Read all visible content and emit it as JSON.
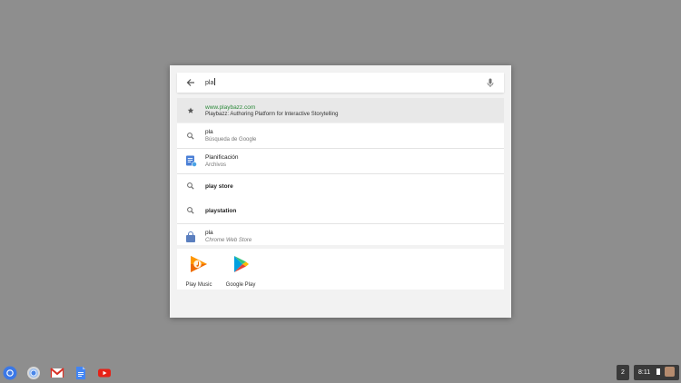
{
  "search": {
    "query": "pla"
  },
  "results": [
    {
      "kind": "site",
      "line1": "www.playbazz.com",
      "line2": "Playbazz: Authoring Platform for Interactive Storytelling",
      "icon": "star-icon"
    },
    {
      "kind": "search",
      "line1": "pla",
      "line2": "Búsqueda de Google",
      "icon": "search-icon"
    },
    {
      "kind": "file",
      "line1": "Planificación",
      "line2": "Archivos",
      "icon": "docs-file-icon"
    },
    {
      "kind": "search",
      "line1": "play store",
      "line2": "",
      "icon": "search-icon"
    },
    {
      "kind": "search",
      "line1": "playstation",
      "line2": "",
      "icon": "search-icon"
    },
    {
      "kind": "store",
      "line1": "pla",
      "line2": "Chrome Web Store",
      "icon": "web-store-icon"
    }
  ],
  "apps": [
    {
      "label": "Play Music",
      "icon": "play-music-icon"
    },
    {
      "label": "Google Play",
      "icon": "google-play-icon"
    }
  ],
  "shelf": {
    "notification_count": "2",
    "time": "8:11"
  },
  "colors": {
    "desktop": "#8e8e8e",
    "url_green": "#2e8b3c",
    "selected_row": "#e8e8e8"
  }
}
